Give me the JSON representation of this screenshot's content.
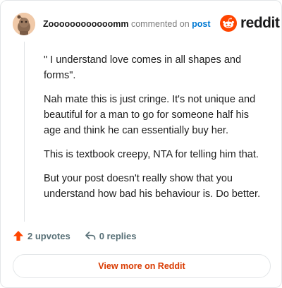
{
  "header": {
    "username": "Zoooooooooooomm",
    "action_text": "commented on",
    "post_link": "post",
    "avatar_icon": "snoo-avatar-icon"
  },
  "brand": {
    "logo_icon": "reddit-snoo-icon",
    "wordmark": "reddit",
    "accent_color": "#ff4500"
  },
  "comment": {
    "paragraphs": [
      "\" I understand love comes in all shapes and forms\".",
      "Nah mate this is just cringe. It's not unique and beautiful for a man to go for someone half his age and think he can essentially buy her.",
      "This is textbook creepy, NTA for telling him that.",
      "But your post doesn't really show that you understand how bad his behaviour is. Do better."
    ]
  },
  "footer": {
    "upvotes": "2 upvotes",
    "replies": "0 replies",
    "upvote_icon": "upvote-arrow-icon",
    "reply_icon": "reply-arrow-icon",
    "upvote_color": "#ff4500"
  },
  "cta": {
    "label": "View more on Reddit"
  }
}
